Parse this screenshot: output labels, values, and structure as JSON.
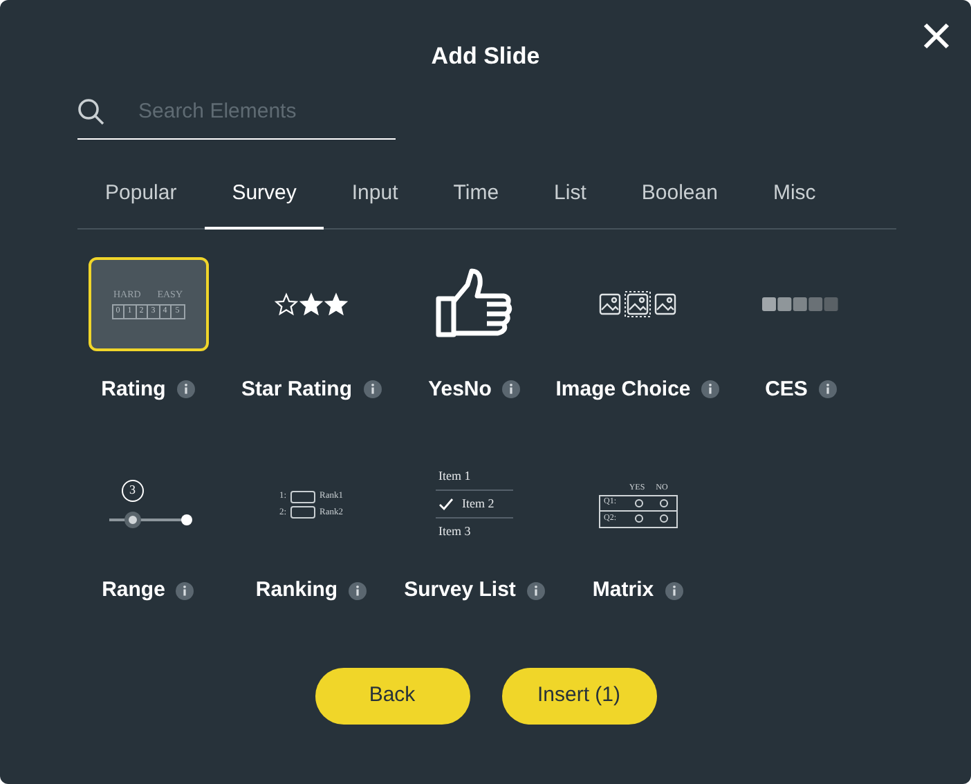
{
  "dialog": {
    "title": "Add Slide"
  },
  "search": {
    "placeholder": "Search Elements"
  },
  "tabs": [
    {
      "label": "Popular",
      "selected": false
    },
    {
      "label": "Survey",
      "selected": true
    },
    {
      "label": "Input",
      "selected": false
    },
    {
      "label": "Time",
      "selected": false
    },
    {
      "label": "List",
      "selected": false
    },
    {
      "label": "Boolean",
      "selected": false
    },
    {
      "label": "Misc",
      "selected": false
    }
  ],
  "elements": [
    {
      "kind": "rating",
      "label": "Rating",
      "selected": true,
      "preview": {
        "low": "HARD",
        "high": "EASY",
        "scale": [
          "0",
          "1",
          "2",
          "3",
          "4",
          "5"
        ]
      }
    },
    {
      "kind": "stars",
      "label": "Star Rating",
      "selected": false,
      "preview": {
        "stars": 2
      }
    },
    {
      "kind": "yesno",
      "label": "YesNo",
      "selected": false
    },
    {
      "kind": "images",
      "label": "Image Choice",
      "selected": false
    },
    {
      "kind": "ces",
      "label": "CES",
      "selected": false
    },
    {
      "kind": "range",
      "label": "Range",
      "selected": false,
      "preview": {
        "value": "3",
        "level": 0.3
      }
    },
    {
      "kind": "ranking",
      "label": "Ranking",
      "selected": false,
      "preview": {
        "rows": [
          {
            "index": "1:",
            "label": "Rank1"
          },
          {
            "index": "2:",
            "label": "Rank2"
          }
        ]
      }
    },
    {
      "kind": "list",
      "label": "Survey List",
      "selected": false,
      "preview": {
        "items": [
          {
            "label": "Item 1",
            "checked": false
          },
          {
            "label": "Item 2",
            "checked": true
          },
          {
            "label": "Item 3",
            "checked": false
          }
        ]
      }
    },
    {
      "kind": "matrix",
      "label": "Matrix",
      "selected": false,
      "preview": {
        "columns": [
          "YES",
          "NO"
        ],
        "rows": [
          "Q1:",
          "Q2:"
        ]
      }
    }
  ],
  "buttons": [
    {
      "label": "Back"
    },
    {
      "label": "Insert (1)"
    }
  ]
}
